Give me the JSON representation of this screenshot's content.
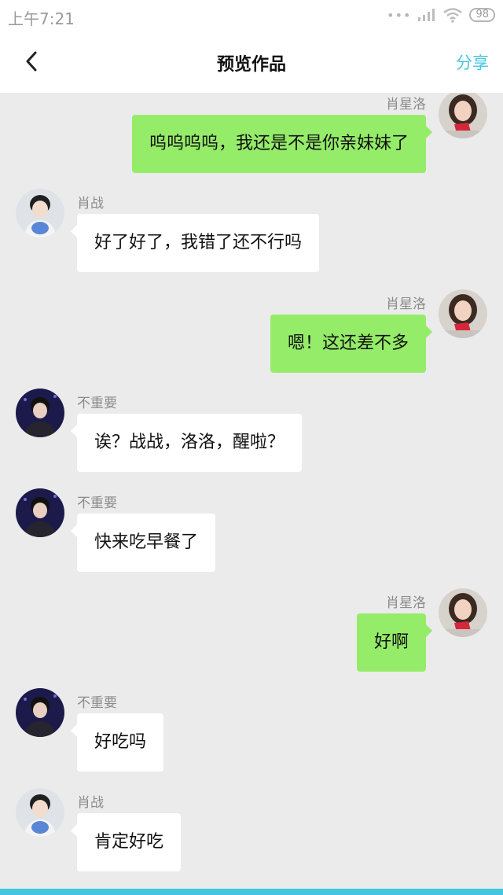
{
  "statusbar": {
    "time": "上午7:21",
    "dots": "•••",
    "battery": "98"
  },
  "header": {
    "title": "预览作品",
    "share": "分享",
    "back_icon": "chevron-left-icon"
  },
  "colors": {
    "self_bubble": "#95ec69",
    "other_bubble": "#ffffff",
    "accent": "#43c6df",
    "background": "#ebebeb"
  },
  "messages": [
    {
      "side": "right",
      "sender": "肖星洛",
      "text": "呜呜呜呜，我还是不是你亲妹妹了",
      "avatar": "xiao-xingluo-avatar"
    },
    {
      "side": "left",
      "sender": "肖战",
      "text": "好了好了，我错了还不行吗",
      "avatar": "xiao-zhan-avatar"
    },
    {
      "side": "right",
      "sender": "肖星洛",
      "text": "嗯！这还差不多",
      "avatar": "xiao-xingluo-avatar"
    },
    {
      "side": "left",
      "sender": "不重要",
      "text": "诶？战战，洛洛，醒啦？",
      "avatar": "bu-zhongyao-avatar"
    },
    {
      "side": "left",
      "sender": "不重要",
      "text": "快来吃早餐了",
      "avatar": "bu-zhongyao-avatar"
    },
    {
      "side": "right",
      "sender": "肖星洛",
      "text": "好啊",
      "avatar": "xiao-xingluo-avatar"
    },
    {
      "side": "left",
      "sender": "不重要",
      "text": "好吃吗",
      "avatar": "bu-zhongyao-avatar"
    },
    {
      "side": "left",
      "sender": "肖战",
      "text": "肯定好吃",
      "avatar": "xiao-zhan-avatar"
    }
  ]
}
